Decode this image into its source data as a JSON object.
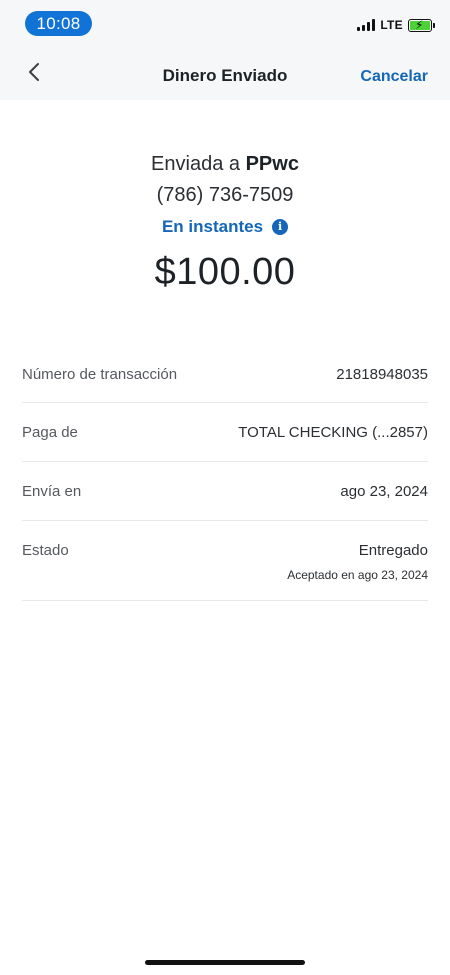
{
  "status_bar": {
    "time": "10:08",
    "network": "LTE",
    "signal_bars": 4,
    "battery_charging": true,
    "colors": {
      "time_pill": "#1273d6",
      "battery_fill": "#4cd137"
    }
  },
  "nav": {
    "back_icon": "chevron-left-icon",
    "title": "Dinero Enviado",
    "cancel_label": "Cancelar"
  },
  "summary": {
    "sent_prefix": "Enviada a",
    "recipient": "PPwc",
    "phone": "(786) 736-7509",
    "speed": "En instantes",
    "info_icon": "info-icon",
    "amount": "$100.00"
  },
  "details": [
    {
      "label": "Número de transacción",
      "value": "21818948035"
    },
    {
      "label": "Paga de",
      "value": "TOTAL CHECKING (...2857)"
    },
    {
      "label": "Envía en",
      "value": "ago 23, 2024"
    },
    {
      "label": "Estado",
      "value": "Entregado",
      "sub": "Aceptado en ago 23, 2024"
    }
  ],
  "colors": {
    "accent": "#1467b8",
    "divider": "#e6e8ea",
    "header_bg": "#f6f7f9"
  }
}
